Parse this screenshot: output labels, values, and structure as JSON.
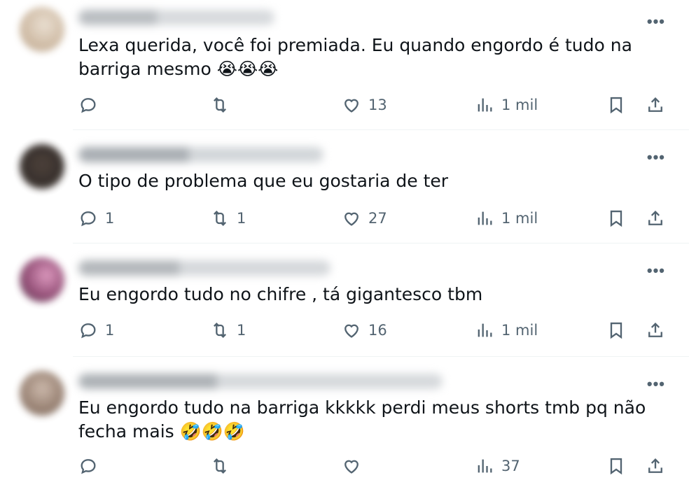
{
  "tweets": [
    {
      "text": "Lexa querida, você foi premiada. Eu quando engordo é tudo na barriga mesmo 😭😭😭",
      "reply_count": "",
      "retweet_count": "",
      "like_count": "13",
      "view_count": "1 mil"
    },
    {
      "text": "O tipo de problema que eu gostaria de ter",
      "reply_count": "1",
      "retweet_count": "1",
      "like_count": "27",
      "view_count": "1 mil"
    },
    {
      "text": "Eu engordo tudo no chifre , tá gigantesco tbm",
      "reply_count": "1",
      "retweet_count": "1",
      "like_count": "16",
      "view_count": "1 mil"
    },
    {
      "text": "Eu engordo tudo na barriga kkkkk perdi meus shorts tmb pq não fecha mais 🤣🤣🤣",
      "reply_count": "",
      "retweet_count": "",
      "like_count": "",
      "view_count": "37"
    }
  ],
  "more_label": "•••",
  "icons": {
    "reply": "reply-icon",
    "retweet": "retweet-icon",
    "like": "heart-icon",
    "views": "views-icon",
    "bookmark": "bookmark-icon",
    "share": "share-icon"
  },
  "colors": {
    "text": "#0f1419",
    "secondary": "#536471",
    "divider": "#eff3f4"
  }
}
